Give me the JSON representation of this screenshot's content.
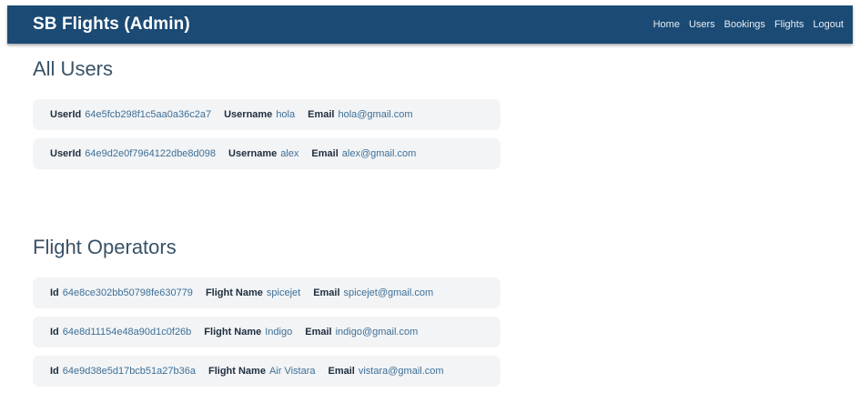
{
  "brand": "SB Flights (Admin)",
  "nav": [
    "Home",
    "Users",
    "Bookings",
    "Flights",
    "Logout"
  ],
  "users_section": {
    "title": "All Users",
    "rows": [
      {
        "id_label": "UserId",
        "id": "64e5fcb298f1c5aa0a36c2a7",
        "name_label": "Username",
        "name": "hola",
        "email_label": "Email",
        "email": "hola@gmail.com"
      },
      {
        "id_label": "UserId",
        "id": "64e9d2e0f7964122dbe8d098",
        "name_label": "Username",
        "name": "alex",
        "email_label": "Email",
        "email": "alex@gmail.com"
      }
    ]
  },
  "operators_section": {
    "title": "Flight Operators",
    "rows": [
      {
        "id_label": "Id",
        "id": "64e8ce302bb50798fe630779",
        "name_label": "Flight Name",
        "name": "spicejet",
        "email_label": "Email",
        "email": "spicejet@gmail.com"
      },
      {
        "id_label": "Id",
        "id": "64e8d11154e48a90d1c0f26b",
        "name_label": "Flight Name",
        "name": "Indigo",
        "email_label": "Email",
        "email": "indigo@gmail.com"
      },
      {
        "id_label": "Id",
        "id": "64e9d38e5d17bcb51a27b36a",
        "name_label": "Flight Name",
        "name": "Air Vistara",
        "email_label": "Email",
        "email": "vistara@gmail.com"
      }
    ]
  }
}
